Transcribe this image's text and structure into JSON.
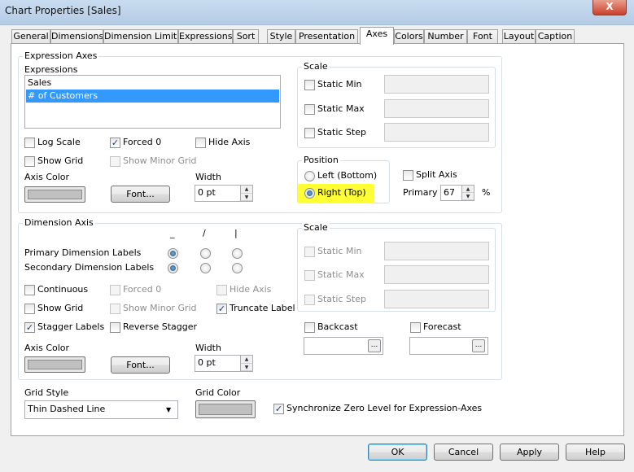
{
  "window": {
    "title": "Chart Properties [Sales]",
    "close_label": "X"
  },
  "tabs": [
    "General",
    "Dimensions",
    "Dimension Limits",
    "Expressions",
    "Sort",
    "Style",
    "Presentation",
    "Axes",
    "Colors",
    "Number",
    "Font",
    "Layout",
    "Caption"
  ],
  "active_tab": "Axes",
  "expression_axes": {
    "group_label": "Expression Axes",
    "expressions_label": "Expressions",
    "expressions": [
      "Sales",
      "# of Customers"
    ],
    "selected_expression": "# of Customers",
    "log_scale": {
      "label": "Log Scale",
      "checked": false
    },
    "forced_0": {
      "label": "Forced 0",
      "checked": true
    },
    "hide_axis": {
      "label": "Hide Axis",
      "checked": false
    },
    "show_grid": {
      "label": "Show Grid",
      "checked": false
    },
    "show_minor_grid": {
      "label": "Show Minor Grid",
      "checked": false,
      "disabled": true
    },
    "axis_color_label": "Axis Color",
    "axis_color": "#c0c0c0",
    "font_button": "Font...",
    "width_label": "Width",
    "width_value": "0 pt",
    "scale": {
      "label": "Scale",
      "static_min": "Static Min",
      "static_max": "Static Max",
      "static_step": "Static Step"
    },
    "position": {
      "label": "Position",
      "left_bottom": "Left (Bottom)",
      "right_top": "Right (Top)",
      "selected": "Right (Top)",
      "highlight_color": "#ffff33"
    },
    "split_axis": {
      "label": "Split Axis",
      "checked": false
    },
    "primary_label": "Primary",
    "primary_value": "67",
    "percent": "%"
  },
  "dimension_axis": {
    "group_label": "Dimension Axis",
    "orientation_headers": [
      "_",
      "/",
      "|"
    ],
    "primary_labels": "Primary Dimension Labels",
    "secondary_labels": "Secondary Dimension Labels",
    "continuous": {
      "label": "Continuous",
      "checked": false
    },
    "forced_0": {
      "label": "Forced 0",
      "checked": false,
      "disabled": true
    },
    "hide_axis": {
      "label": "Hide Axis",
      "checked": false,
      "disabled": true
    },
    "show_grid": {
      "label": "Show Grid",
      "checked": false
    },
    "show_minor_grid": {
      "label": "Show Minor Grid",
      "checked": false,
      "disabled": true
    },
    "truncate_label": {
      "label": "Truncate Label",
      "checked": true
    },
    "stagger_labels": {
      "label": "Stagger Labels",
      "checked": true
    },
    "reverse_stagger": {
      "label": "Reverse Stagger",
      "checked": false
    },
    "axis_color_label": "Axis Color",
    "axis_color": "#c0c0c0",
    "font_button": "Font...",
    "width_label": "Width",
    "width_value": "0 pt",
    "scale": {
      "label": "Scale",
      "static_min": "Static Min",
      "static_max": "Static Max",
      "static_step": "Static Step"
    },
    "backcast": "Backcast",
    "forecast": "Forecast",
    "ellipsis": "..."
  },
  "grid_style": {
    "label": "Grid Style",
    "value": "Thin Dashed Line"
  },
  "grid_color": {
    "label": "Grid Color",
    "color": "#c0c0c0"
  },
  "sync_zero": {
    "label": "Synchronize Zero Level for Expression-Axes",
    "checked": true
  },
  "buttons": {
    "ok": "OK",
    "cancel": "Cancel",
    "apply": "Apply",
    "help": "Help"
  },
  "check_glyph": "✓",
  "dropdown_glyph": "▼",
  "spin_up": "▲",
  "spin_down": "▼"
}
